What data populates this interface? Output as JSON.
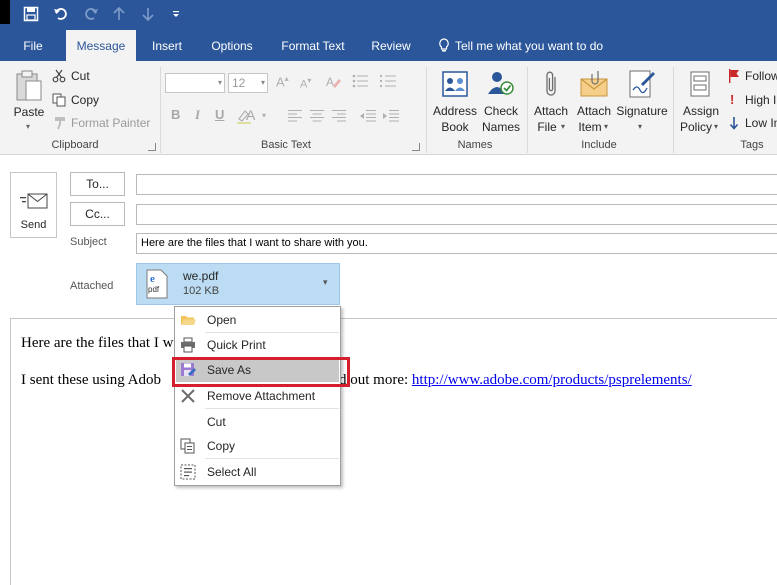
{
  "tabs": {
    "file": "File",
    "message": "Message",
    "insert": "Insert",
    "options": "Options",
    "format_text": "Format Text",
    "review": "Review",
    "tell_me": "Tell me what you want to do"
  },
  "ribbon": {
    "clipboard": {
      "paste": "Paste",
      "cut": "Cut",
      "copy": "Copy",
      "format_painter": "Format Painter",
      "label": "Clipboard"
    },
    "basic_text": {
      "font_size": "12",
      "bold": "B",
      "italic": "I",
      "underline": "U",
      "font_color": "A",
      "label": "Basic Text"
    },
    "names": {
      "address_book_1": "Address",
      "address_book_2": "Book",
      "check_names_1": "Check",
      "check_names_2": "Names",
      "label": "Names"
    },
    "include": {
      "attach_file_1": "Attach",
      "attach_file_2": "File",
      "attach_item_1": "Attach",
      "attach_item_2": "Item",
      "signature": "Signature",
      "label": "Include"
    },
    "tags": {
      "assign_policy_1": "Assign",
      "assign_policy_2": "Policy",
      "follow_up": "Follow",
      "high_importance": "High Im",
      "low_importance": "Low Im",
      "label": "Tags"
    }
  },
  "compose": {
    "send": "Send",
    "to": "To...",
    "cc": "Cc...",
    "subject_label": "Subject",
    "subject_value": "Here are the files that I want to share with you.",
    "attached_label": "Attached",
    "attachment": {
      "name": "we.pdf",
      "size": "102 KB",
      "icon_text": "pdf"
    }
  },
  "body": {
    "line1": "Here are the files that I w",
    "line2_start": "I sent these using Adob",
    "line2_end": "d out more: ",
    "link": "http://www.adobe.com/products/psprelements/"
  },
  "context_menu": {
    "items": [
      "Open",
      "Quick Print",
      "Save As",
      "Remove Attachment",
      "Cut",
      "Copy",
      "Select All"
    ],
    "highlighted": "Save As"
  },
  "colors": {
    "ribbon_blue": "#2b579a",
    "highlight_box": "#d4202c",
    "attachment_bg": "#bcdcf4"
  }
}
